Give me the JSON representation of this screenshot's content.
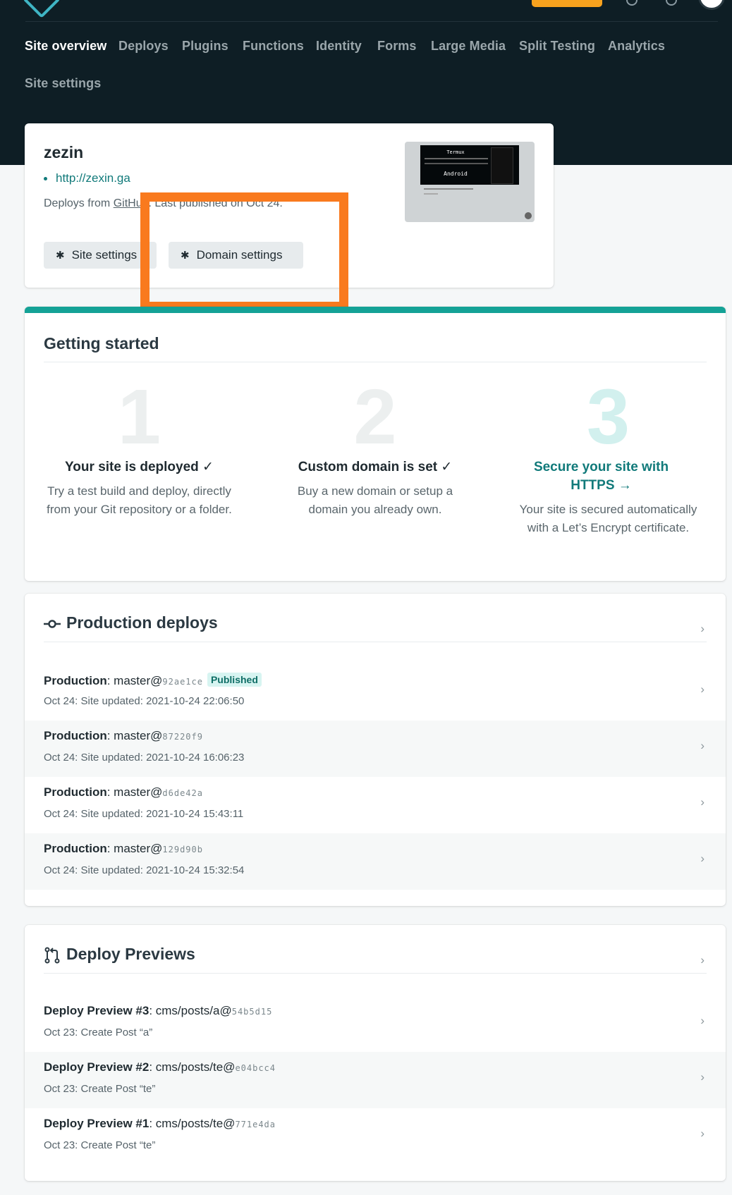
{
  "nav": {
    "items": [
      "Site overview",
      "Deploys",
      "Plugins",
      "Functions",
      "Identity",
      "Forms",
      "Large Media",
      "Split Testing",
      "Analytics",
      "Site settings"
    ]
  },
  "site": {
    "name": "zezin",
    "url": "http://zexin.ga",
    "deploys_from_prefix": "Deploys from ",
    "deploys_from_source": "GitHub",
    "published_text": ". Last published on Oct 24.",
    "site_settings_button": "Site settings",
    "domain_settings_button": "Domain settings",
    "thumb": {
      "title": "Termux",
      "subtitle": "Android"
    }
  },
  "getting_started": {
    "title": "Getting started",
    "steps": [
      {
        "number": "1",
        "title": "Your site is deployed ✓",
        "description": "Try a test build and deploy, directly from your Git repository or a folder."
      },
      {
        "number": "2",
        "title": "Custom domain is set ✓",
        "description": "Buy a new domain or setup a domain you already own."
      },
      {
        "number": "3",
        "title": "Secure your site with HTTPS →",
        "description": "Your site is secured automatically with a Let’s Encrypt certificate."
      }
    ]
  },
  "production_deploys": {
    "title": "Production deploys",
    "rows": [
      {
        "label": "Production",
        "branch": ": master@",
        "hash": "92ae1ce",
        "badge": "Published",
        "summary": "Oct 24: Site updated: 2021-10-24 22:06:50"
      },
      {
        "label": "Production",
        "branch": ": master@",
        "hash": "87220f9",
        "summary": "Oct 24: Site updated: 2021-10-24 16:06:23"
      },
      {
        "label": "Production",
        "branch": ": master@",
        "hash": "d6de42a",
        "summary": "Oct 24: Site updated: 2021-10-24 15:43:11"
      },
      {
        "label": "Production",
        "branch": ": master@",
        "hash": "129d90b",
        "summary": "Oct 24: Site updated: 2021-10-24 15:32:54"
      }
    ]
  },
  "deploy_previews": {
    "title": "Deploy Previews",
    "rows": [
      {
        "label": "Deploy Preview #3",
        "branch": ": cms/posts/a@",
        "hash": "54b5d15",
        "summary": "Oct 23: Create Post “a”"
      },
      {
        "label": "Deploy Preview #2",
        "branch": ": cms/posts/te@",
        "hash": "e04bcc4",
        "summary": "Oct 23: Create Post “te”"
      },
      {
        "label": "Deploy Preview #1",
        "branch": ": cms/posts/te@",
        "hash": "771e4da",
        "summary": "Oct 23: Create Post “te”"
      }
    ]
  },
  "colors": {
    "header_bg": "#0e1e25",
    "accent_teal": "#14a296",
    "highlight_orange": "#f97a1e",
    "upgrade_button": "#f7a21e"
  },
  "icons": [
    "logo-icon",
    "gear-icon",
    "commit-icon",
    "pull-request-icon",
    "chevron-right-icon"
  ]
}
